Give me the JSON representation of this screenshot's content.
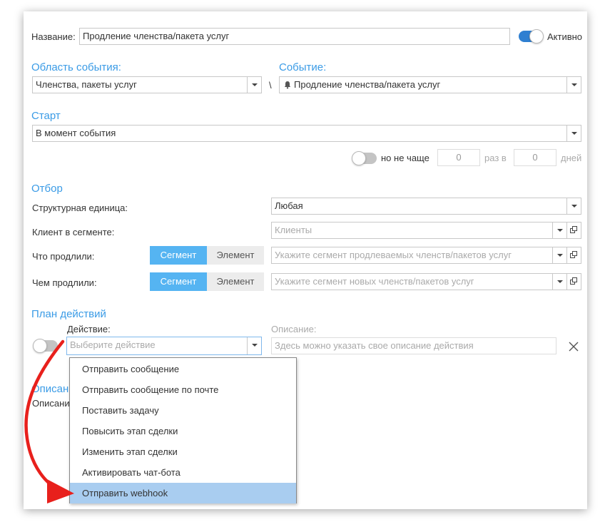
{
  "form": {
    "name_label": "Название:",
    "name_value": "Продление членства/пакета услуг",
    "active_label": "Активно",
    "event_area_label": "Область события:",
    "event_area_value": "Членства, пакеты услуг",
    "separator": "\\",
    "event_label": "Событие:",
    "event_value": "Продление членства/пакета услуг",
    "start_label": "Старт",
    "start_value": "В момент события",
    "freq_label": "но не чаще",
    "freq_count": "0",
    "freq_times_label": "раз в",
    "freq_days": "0",
    "freq_days_label": "дней"
  },
  "filter": {
    "title": "Отбор",
    "unit_label": "Структурная единица:",
    "unit_value": "Любая",
    "client_label": "Клиент в сегменте:",
    "client_placeholder": "Клиенты",
    "what_label": "Что продлили:",
    "what_placeholder": "Укажите сегмент продлеваемых членств/пакетов услуг",
    "with_label": "Чем продлили:",
    "with_placeholder": "Укажите сегмент новых членств/пакетов услуг",
    "seg_button": "Сегмент",
    "elem_button": "Элемент"
  },
  "plan": {
    "title": "План действий",
    "action_label": "Действие:",
    "action_placeholder": "Выберите действие",
    "desc_label": "Описание:",
    "desc_placeholder": "Здесь можно указать свое описание действия"
  },
  "description": {
    "title": "Описание",
    "label": "Описание"
  },
  "action_menu": {
    "items": [
      "Отправить сообщение",
      "Отправить сообщение по почте",
      "Поставить задачу",
      "Повысить этап сделки",
      "Изменить этап сделки",
      "Активировать чат-бота",
      "Отправить webhook"
    ],
    "selected_index": 6
  },
  "colors": {
    "accent": "#3a9be6",
    "segment_active": "#55b4f2",
    "toggle_on": "#2f7fd1",
    "toggle_off": "#c4c4c4",
    "menu_selected": "#a9cdf0",
    "annotation_arrow": "#e8201c"
  },
  "icons": {
    "bell": "bell-icon",
    "open_external": "open-external-icon",
    "close": "close-icon"
  }
}
